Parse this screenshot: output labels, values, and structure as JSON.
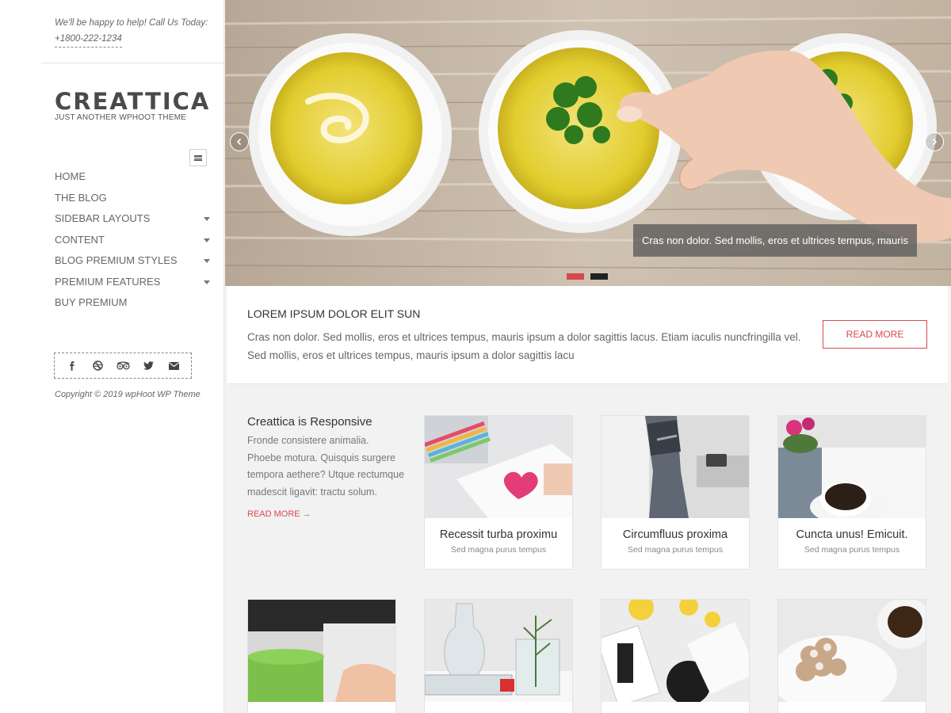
{
  "topbar": {
    "line1": "We'll be happy to help! Call Us Today:",
    "phone": "+1800-222-1234"
  },
  "brand": {
    "name": "CREATTICA",
    "tagline": "JUST ANOTHER WPHOOT THEME"
  },
  "nav": {
    "items": [
      {
        "label": "HOME",
        "has_dropdown": false
      },
      {
        "label": "THE BLOG",
        "has_dropdown": false
      },
      {
        "label": "SIDEBAR LAYOUTS",
        "has_dropdown": true
      },
      {
        "label": "CONTENT",
        "has_dropdown": true
      },
      {
        "label": "BLOG PREMIUM STYLES",
        "has_dropdown": true
      },
      {
        "label": "PREMIUM FEATURES",
        "has_dropdown": true
      },
      {
        "label": "BUY PREMIUM",
        "has_dropdown": false
      }
    ]
  },
  "social": [
    "facebook-icon",
    "dribbble-icon",
    "tripadvisor-icon",
    "twitter-icon",
    "email-icon"
  ],
  "copyright": "Copyright © 2019 wpHoot WP Theme",
  "slider": {
    "caption": "Cras non dolor. Sed mollis, eros et ultrices tempus, mauris",
    "active_dot": 0,
    "dot_count": 2
  },
  "intro": {
    "title": "LOREM IPSUM DOLOR ELIT SUN",
    "text": "Cras non dolor. Sed mollis, eros et ultrices tempus, mauris ipsum a dolor sagittis lacus. Etiam iaculis nuncfringilla vel. Sed mollis, eros et ultrices tempus, mauris ipsum a dolor sagittis lacu",
    "button": "READ MORE"
  },
  "feature": {
    "title": "Creattica is Responsive",
    "text": "Fronde consistere animalia. Phoebe motura. Quisquis surgere tempora aethere? Utque rectumque madescit ligavit: tractu solum.",
    "more": "READ MORE →"
  },
  "cards": [
    {
      "title": "Recessit turba proximu",
      "subtitle": "Sed magna purus tempus"
    },
    {
      "title": "Circumfluus proxima",
      "subtitle": "Sed magna purus tempus"
    },
    {
      "title": "Cuncta unus! Emicuit.",
      "subtitle": "Sed magna purus tempus"
    }
  ],
  "colors": {
    "accent": "#d9484e",
    "dot_active": "#d9484e",
    "dot_inactive": "#222222",
    "text": "#666666"
  }
}
